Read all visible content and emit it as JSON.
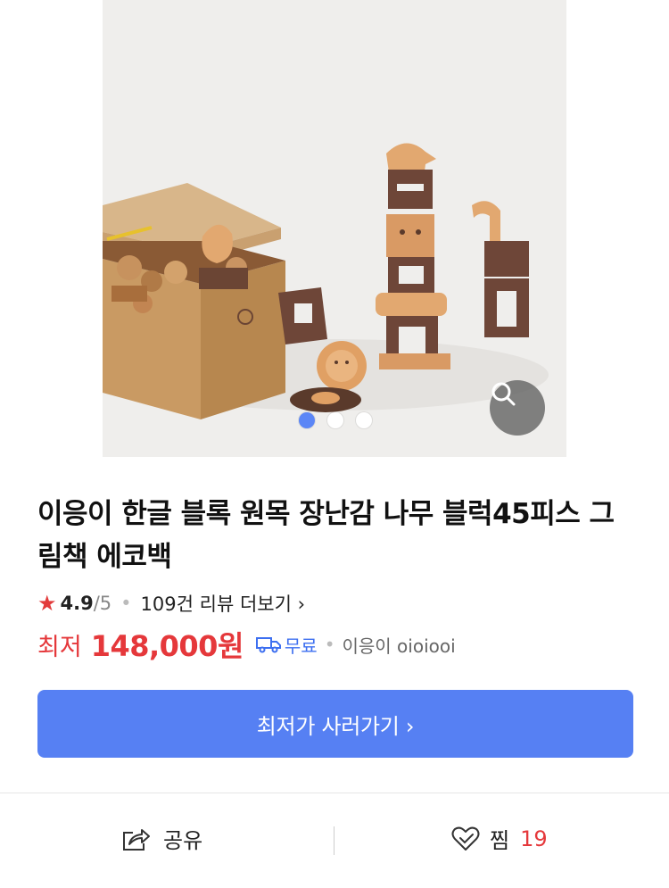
{
  "product": {
    "title": "이응이 한글 블록 원목 장난감 나무 블럭45피스 그림책 에코백",
    "rating": {
      "value": "4.9",
      "max": "/5",
      "review_link": "109건 리뷰 더보기 ›"
    },
    "price": {
      "label": "최저",
      "value": "148,000원"
    },
    "shipping": "무료",
    "seller": "이응이 oioiooi"
  },
  "gallery": {
    "slide_count": 3,
    "active_index": 0
  },
  "cta": {
    "label": "최저가 사러가기 ›"
  },
  "bottom_bar": {
    "share_label": "공유",
    "like_label": "찜",
    "like_count": "19"
  },
  "colors": {
    "accent_blue": "#5680f3",
    "price_red": "#e5383b",
    "shipping_blue": "#3d6ff0"
  }
}
